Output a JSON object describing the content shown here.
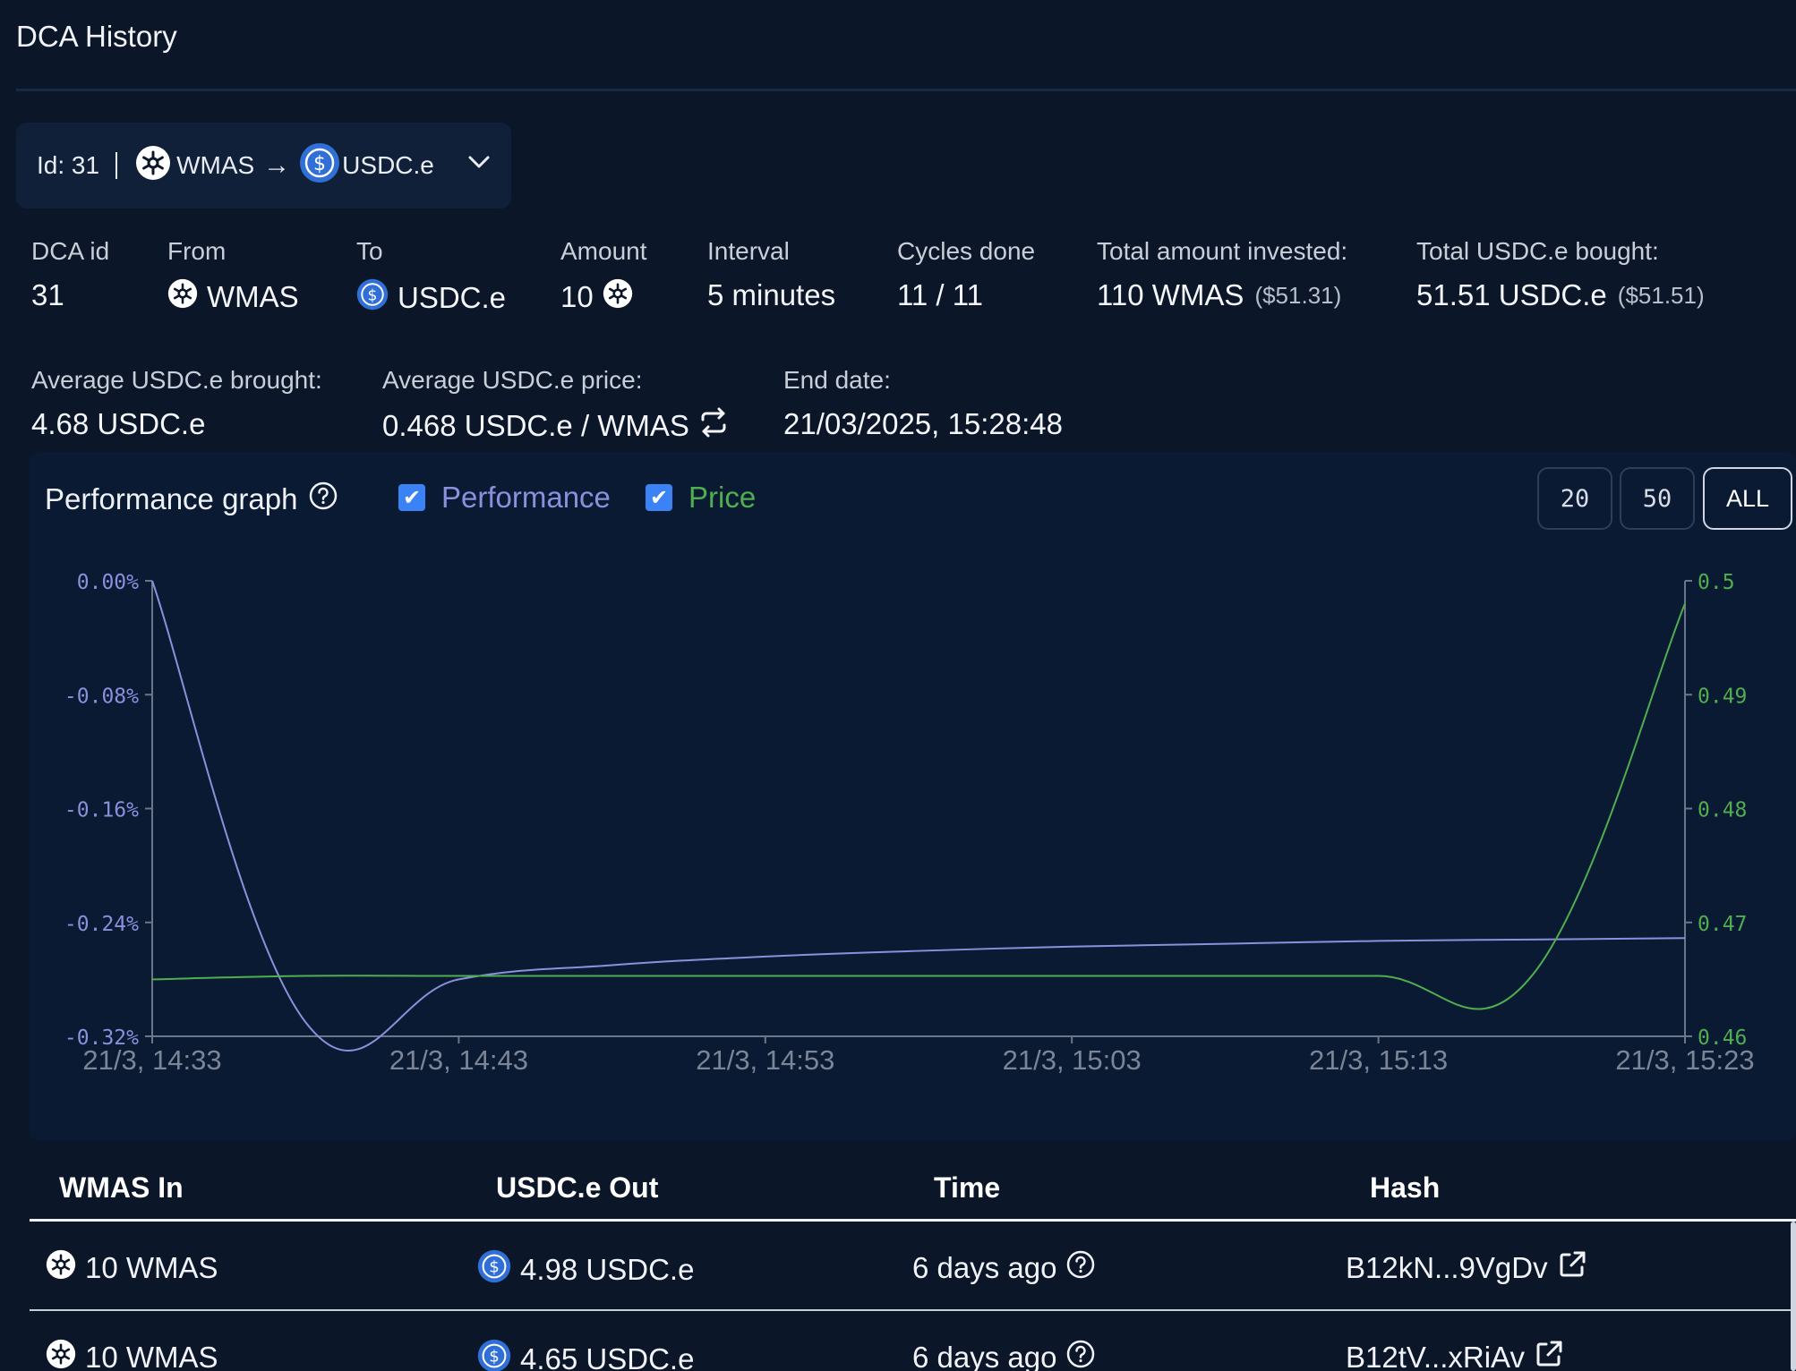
{
  "page": {
    "title": "DCA History"
  },
  "selector": {
    "id_label": "Id: 31",
    "from_token": "WMAS",
    "arrow": "→",
    "to_token": "USDC.e"
  },
  "stats": {
    "dca_id": {
      "label": "DCA id",
      "value": "31"
    },
    "from": {
      "label": "From",
      "value": "WMAS"
    },
    "to": {
      "label": "To",
      "value": "USDC.e"
    },
    "amount": {
      "label": "Amount",
      "value": "10"
    },
    "interval": {
      "label": "Interval",
      "value": "5 minutes"
    },
    "cycles": {
      "label": "Cycles done",
      "value": "11 / 11"
    },
    "total_invested": {
      "label": "Total amount invested:",
      "value": "110 WMAS",
      "usd": "($51.31)"
    },
    "total_bought": {
      "label": "Total USDC.e bought:",
      "value": "51.51 USDC.e",
      "usd": "($51.51)"
    },
    "avg_bought": {
      "label": "Average USDC.e brought:",
      "value": "4.68 USDC.e"
    },
    "avg_price": {
      "label": "Average USDC.e price:",
      "value": "0.468 USDC.e / WMAS"
    },
    "end_date": {
      "label": "End date:",
      "value": "21/03/2025, 15:28:48"
    }
  },
  "chart": {
    "title": "Performance graph",
    "legend": {
      "performance": "Performance",
      "price": "Price",
      "check": "✔"
    },
    "ranges": [
      "20",
      "50",
      "ALL"
    ],
    "active_range": "ALL",
    "colors": {
      "performance": "#8b8fdc",
      "price": "#4fae4f",
      "axis": "#6b7688",
      "tick": "#7b8595"
    }
  },
  "chart_data": {
    "type": "line",
    "x": [
      "21/3, 14:33",
      "21/3, 14:38",
      "21/3, 14:43",
      "21/3, 14:48",
      "21/3, 14:53",
      "21/3, 14:58",
      "21/3, 15:03",
      "21/3, 15:08",
      "21/3, 15:13",
      "21/3, 15:18",
      "21/3, 15:23"
    ],
    "x_tick_labels": [
      "21/3, 14:33",
      "21/3, 14:43",
      "21/3, 14:53",
      "21/3, 15:03",
      "21/3, 15:13",
      "21/3, 15:23"
    ],
    "series": [
      {
        "name": "Performance",
        "axis": "left",
        "values": [
          0.0,
          -0.31,
          -0.28,
          -0.27,
          -0.264,
          -0.26,
          -0.257,
          -0.255,
          -0.253,
          -0.252,
          -0.251
        ]
      },
      {
        "name": "Price",
        "axis": "right",
        "values": [
          0.465,
          0.4653,
          0.4653,
          0.4653,
          0.4653,
          0.4653,
          0.4653,
          0.4653,
          0.4653,
          0.4653,
          0.498
        ]
      }
    ],
    "y_left": {
      "lim": [
        -0.32,
        0.0
      ],
      "ticks": [
        "0.00%",
        "-0.08%",
        "-0.16%",
        "-0.24%",
        "-0.32%"
      ]
    },
    "y_right": {
      "lim": [
        0.46,
        0.5
      ],
      "ticks": [
        "0.5",
        "0.49",
        "0.48",
        "0.47",
        "0.46"
      ]
    }
  },
  "table": {
    "headers": [
      "WMAS In",
      "USDC.e Out",
      "Time",
      "Hash"
    ],
    "rows": [
      {
        "in": "10 WMAS",
        "out": "4.98 USDC.e",
        "time": "6 days ago",
        "hash": "B12kN...9VgDv"
      },
      {
        "in": "10 WMAS",
        "out": "4.65 USDC.e",
        "time": "6 days ago",
        "hash": "B12tV...xRiAv"
      }
    ]
  }
}
